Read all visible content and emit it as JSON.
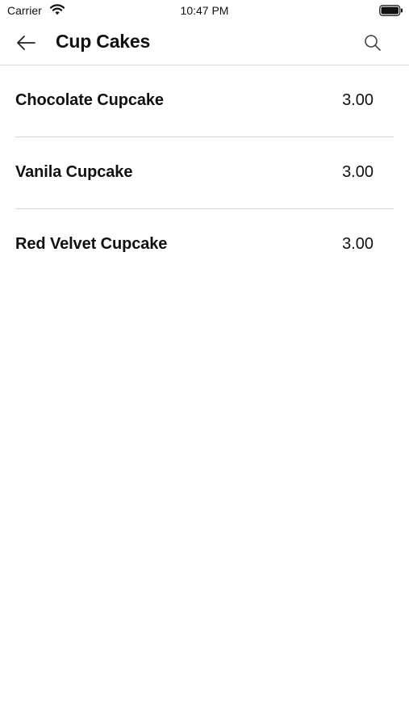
{
  "status_bar": {
    "carrier": "Carrier",
    "time": "10:47 PM",
    "wifi_icon": "wifi-icon",
    "battery_icon": "battery-icon"
  },
  "nav": {
    "title": "Cup Cakes",
    "back_icon": "arrow-left-icon",
    "search_icon": "search-icon"
  },
  "items": [
    {
      "name": "Chocolate Cupcake",
      "price": "3.00"
    },
    {
      "name": "Vanila Cupcake",
      "price": "3.00"
    },
    {
      "name": "Red Velvet Cupcake",
      "price": "3.00"
    }
  ],
  "colors": {
    "text": "#111111",
    "divider": "#d8d8d8",
    "background": "#ffffff"
  }
}
